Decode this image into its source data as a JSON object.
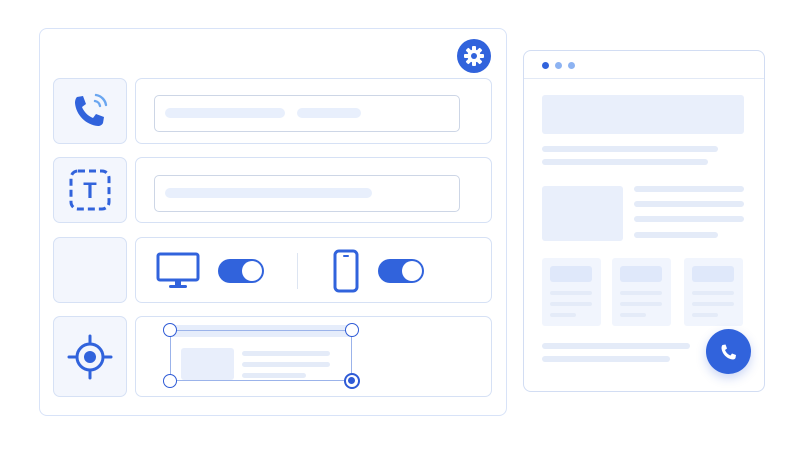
{
  "colors": {
    "accent": "#3163dc",
    "accent_light": "#6aa6f0",
    "panel_border": "#d6e1f5",
    "placeholder": "#e8effc"
  },
  "editor": {
    "settings_icon": "gear-icon",
    "rows": [
      {
        "icon": "phone-ringing-icon",
        "kind": "text-fields"
      },
      {
        "icon": "text-box-icon",
        "icon_text": "T",
        "kind": "text-field"
      },
      {
        "icon": "",
        "kind": "device-toggles",
        "toggles": [
          {
            "icon": "desktop-icon",
            "on": true
          },
          {
            "icon": "mobile-icon",
            "on": true
          }
        ]
      },
      {
        "icon": "target-icon",
        "kind": "selection-frame"
      }
    ]
  },
  "preview": {
    "window_dots": [
      "#3163dc",
      "#8db3f2",
      "#8db3f2"
    ],
    "call_button_icon": "phone-icon"
  }
}
